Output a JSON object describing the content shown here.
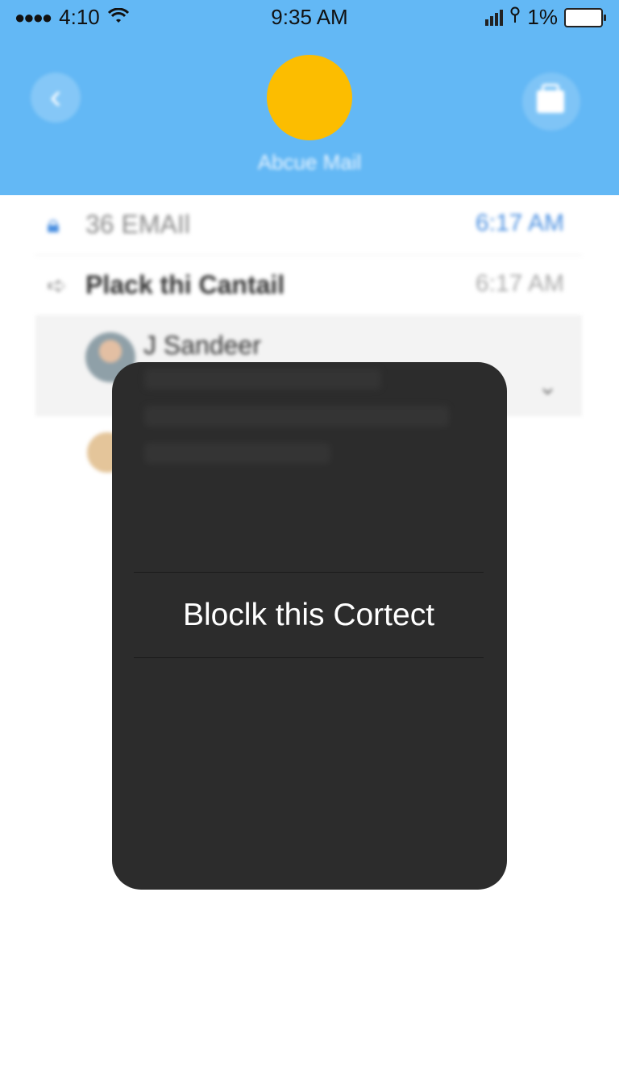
{
  "status_bar": {
    "carrier_time": "4:10",
    "clock": "9:35 AM",
    "battery_percent": "1%"
  },
  "header": {
    "title": "Abcue Mail",
    "avatar_color": "#fcbd00",
    "background": "#63b8f5"
  },
  "list": {
    "rows": [
      {
        "icon": "lock-icon",
        "label": "36 EMAIl",
        "time": "6:17 AM"
      },
      {
        "icon": "forward-arrow-icon",
        "label": "Plack thi Cantail",
        "time": "6:17 AM"
      }
    ],
    "selected": {
      "name": "J Sandeer"
    }
  },
  "modal": {
    "action_label": "Bloclk this Cortect"
  }
}
